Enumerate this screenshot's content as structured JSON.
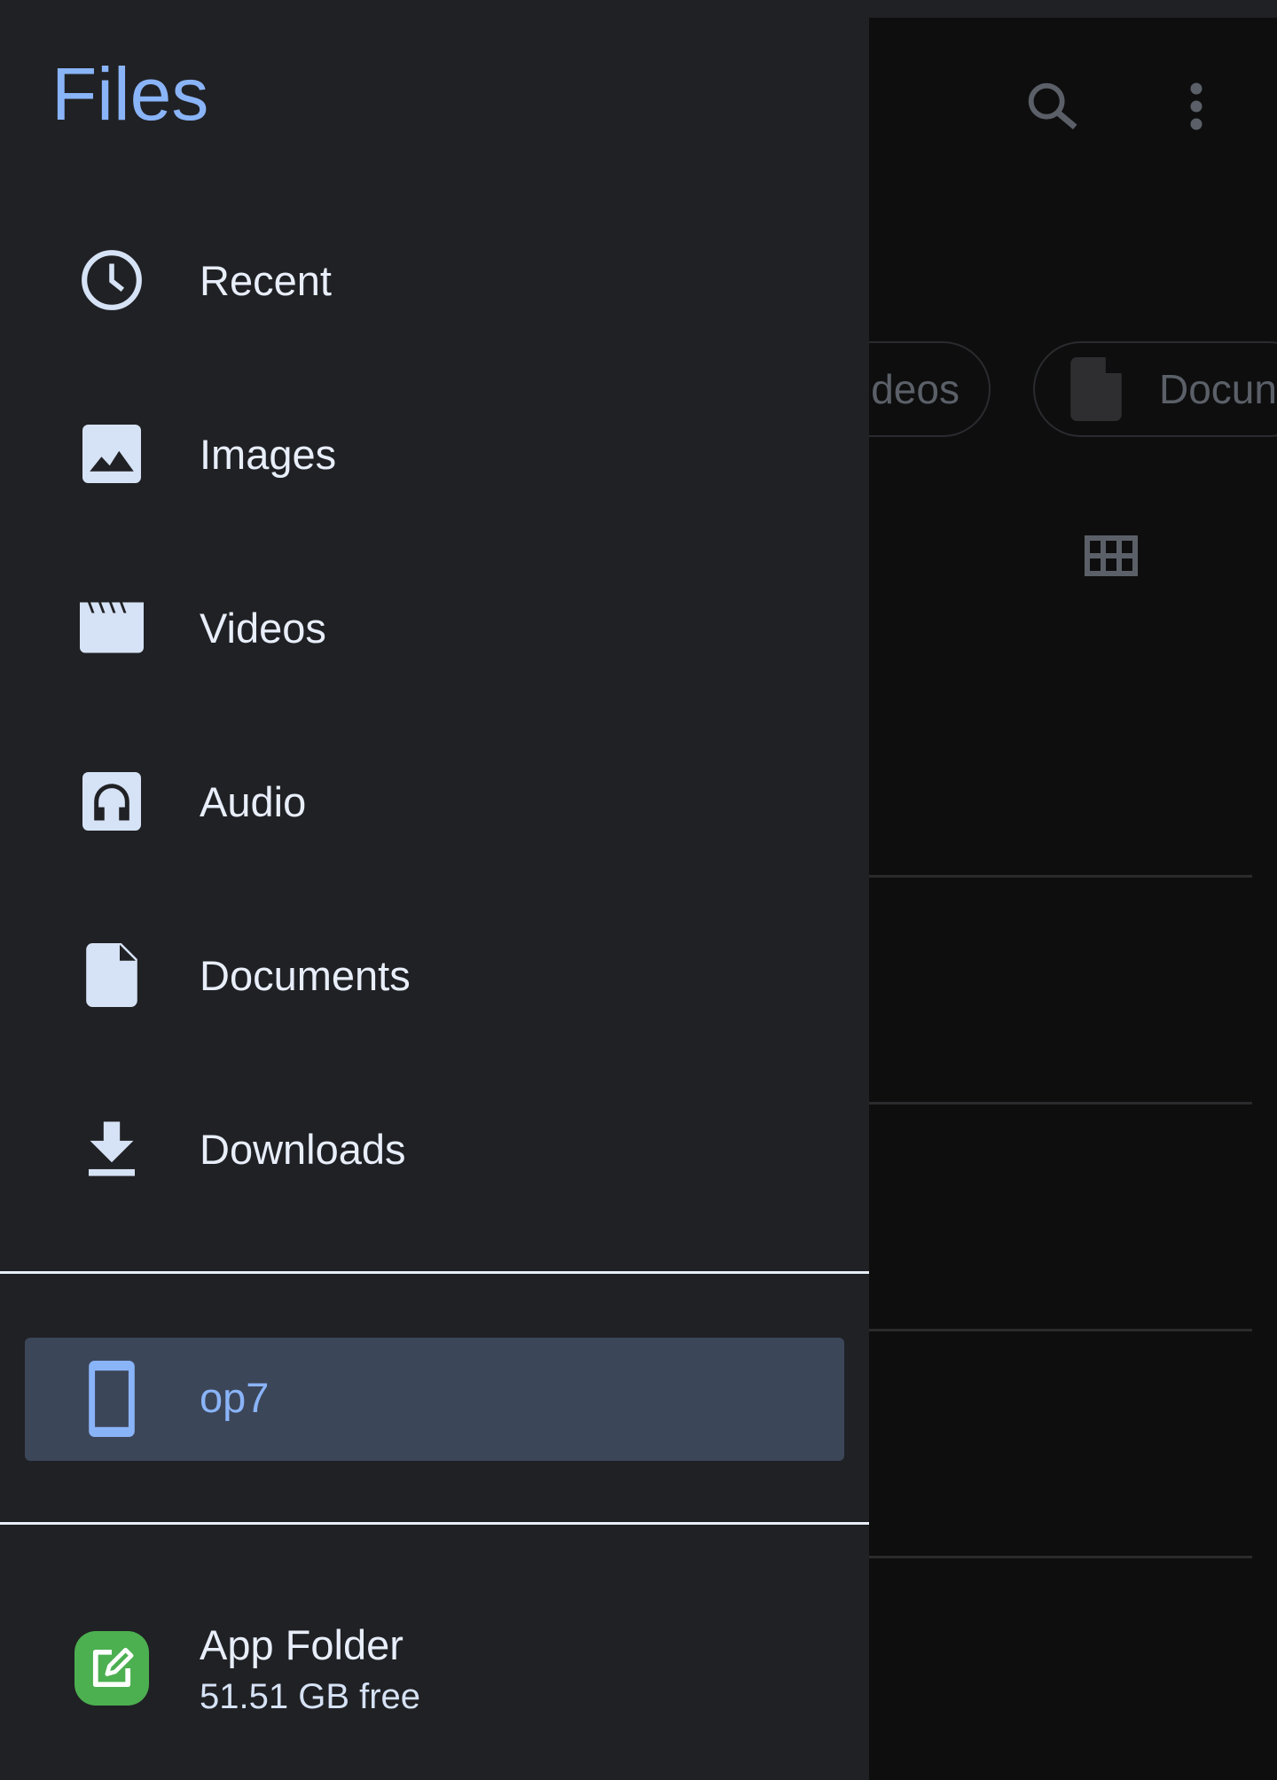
{
  "app": {
    "title": "Files"
  },
  "colors": {
    "accent": "#8ab4f8",
    "drawer_bg": "#202124",
    "selected_bg": "#3c4659",
    "app_icon": "#4caf50"
  },
  "drawer": {
    "items": [
      {
        "label": "Recent",
        "icon": "clock-icon"
      },
      {
        "label": "Images",
        "icon": "image-icon"
      },
      {
        "label": "Videos",
        "icon": "video-icon"
      },
      {
        "label": "Audio",
        "icon": "audio-icon"
      },
      {
        "label": "Documents",
        "icon": "document-icon"
      },
      {
        "label": "Downloads",
        "icon": "download-icon"
      }
    ],
    "device": {
      "label": "op7",
      "icon": "phone-icon",
      "selected": true
    },
    "app_folder": {
      "name": "App Folder",
      "free": "51.51 GB free",
      "icon": "app-folder-edit-icon"
    }
  },
  "background": {
    "toolbar": {
      "search_icon": "search-icon",
      "menu_icon": "more-vert-icon"
    },
    "chips": [
      {
        "label": "Videos",
        "visible_text": "ideos"
      },
      {
        "label": "Documents",
        "visible_text": "Docun",
        "icon": "document-icon"
      }
    ],
    "view_toggle_icon": "grid-view-icon"
  }
}
